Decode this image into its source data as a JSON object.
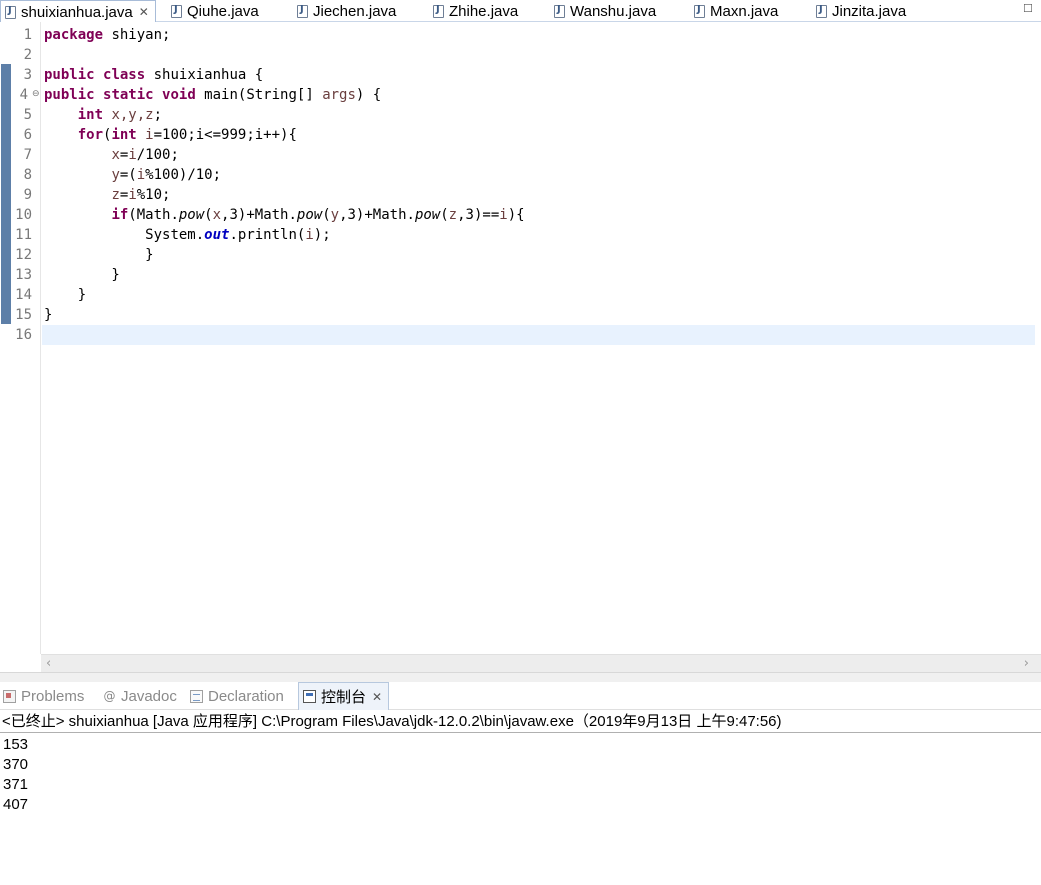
{
  "editor_tabs": [
    {
      "label": "shuixianhua.java",
      "close": "✕"
    },
    {
      "label": "Qiuhe.java"
    },
    {
      "label": "Jiechen.java"
    },
    {
      "label": "Zhihe.java"
    },
    {
      "label": "Wanshu.java"
    },
    {
      "label": "Maxn.java"
    },
    {
      "label": "Jinzita.java"
    }
  ],
  "line_numbers": [
    "1",
    "2",
    "3",
    "4",
    "5",
    "6",
    "7",
    "8",
    "9",
    "10",
    "11",
    "12",
    "13",
    "14",
    "15",
    "16"
  ],
  "fold_marker": "⊖",
  "code": {
    "l1": {
      "kw": "package",
      "rest": " shiyan;"
    },
    "l3": {
      "kw1": "public",
      "kw2": "class",
      "rest": " shuixianhua {"
    },
    "l4": {
      "kw1": "public",
      "kw2": "static",
      "kw3": "void",
      "a": " main(String[] ",
      "var": "args",
      "b": ") {"
    },
    "l5": {
      "indent": "    ",
      "kw": "int",
      "vars": " x,y,z",
      "end": ";"
    },
    "l6": {
      "indent": "    ",
      "kw1": "for",
      "p": "(",
      "kw2": "int",
      "var": " i",
      "rest": "=100;i<=999;i++){"
    },
    "l7": {
      "indent": "        ",
      "var1": "x",
      "eq": "=",
      "var2": "i",
      "rest": "/100;"
    },
    "l8": {
      "indent": "        ",
      "var1": "y",
      "eq": "=(",
      "var2": "i",
      "rest": "%100)/10;"
    },
    "l9": {
      "indent": "        ",
      "var1": "z",
      "eq": "=",
      "var2": "i",
      "rest": "%10;"
    },
    "l10": {
      "indent": "        ",
      "kw": "if",
      "a": "(Math.",
      "pow": "pow",
      "b": "(",
      "x": "x",
      "c": ",3)+Math.",
      "y": "y",
      "d": ",3)+Math.",
      "z": "z",
      "e": ",3)==",
      "i": "i",
      "f": "){"
    },
    "l11": {
      "indent": "            ",
      "a": "System.",
      "out": "out",
      "b": ".println(",
      "i": "i",
      "c": ");"
    },
    "l12": {
      "text": "            }"
    },
    "l13": {
      "text": "        }"
    },
    "l14": {
      "text": "    }"
    },
    "l15": {
      "text": "}"
    }
  },
  "scroll_arrows": {
    "left": "‹",
    "right": "›"
  },
  "overflow": "☐",
  "panel_tabs": [
    {
      "label": "Problems"
    },
    {
      "label": "Javadoc",
      "glyph": "@"
    },
    {
      "label": "Declaration"
    },
    {
      "label": "控制台",
      "close": "✕"
    }
  ],
  "console": {
    "header": "<已终止> shuixianhua [Java 应用程序] C:\\Program Files\\Java\\jdk-12.0.2\\bin\\javaw.exe（2019年9月13日 上午9:47:56)",
    "output": [
      "153",
      "370",
      "371",
      "407"
    ]
  },
  "colors": {
    "keyword": "#7f0055",
    "variable": "#6a3e3e",
    "field": "#0000c0",
    "current_line": "#e8f2fe",
    "change_bar": "#5d7fa8"
  }
}
